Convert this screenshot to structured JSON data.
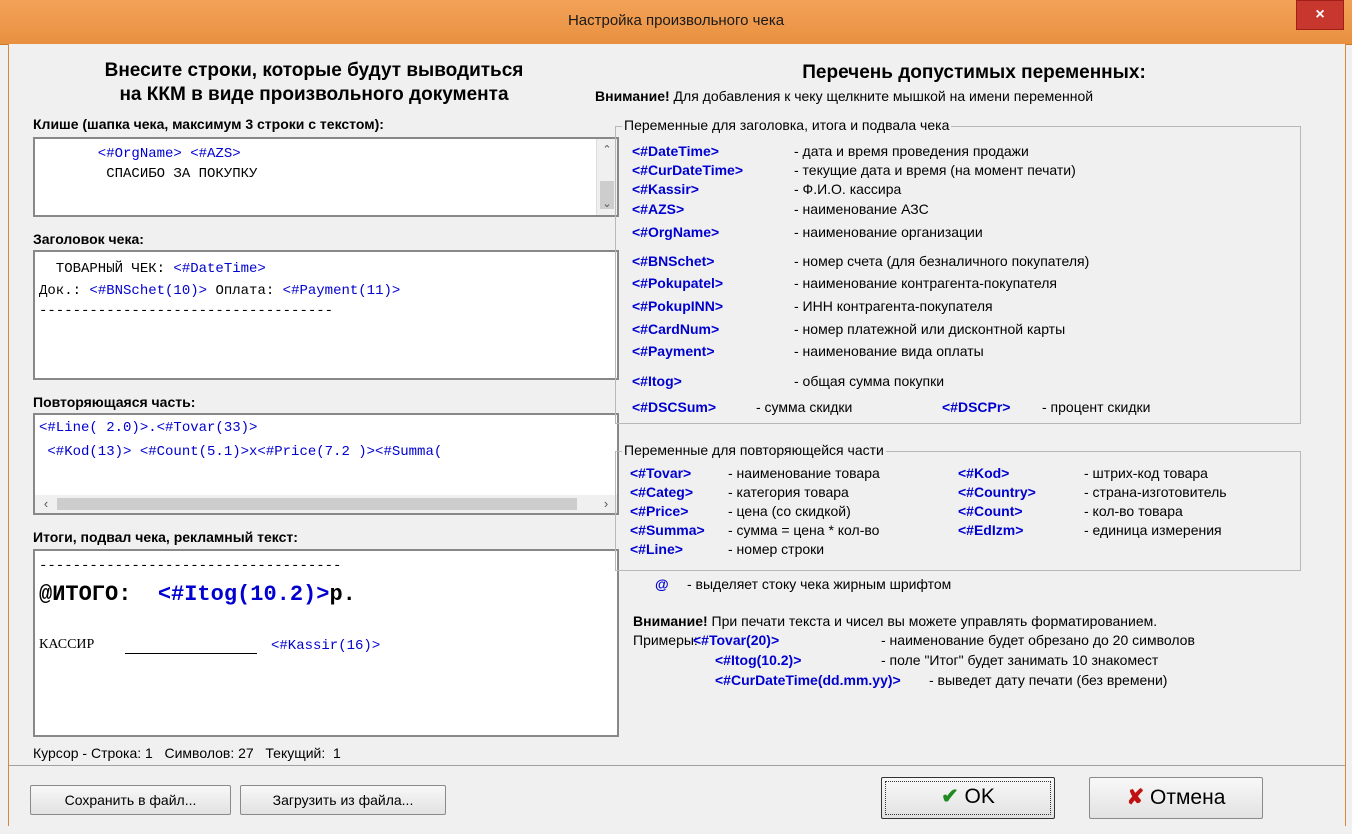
{
  "window": {
    "title": "Настройка произвольного чека",
    "close_glyph": "×"
  },
  "left": {
    "header": [
      "Внесите строки, которые будут выводиться",
      "на ККМ в виде произвольного документа"
    ],
    "cliche": {
      "label": "Клише (шапка чека, максимум 3 строки с текстом):",
      "line1": "       <#OrgName> <#AZS>",
      "line2": "        СПАСИБО ЗА ПОКУПКУ"
    },
    "heading": {
      "label": "Заголовок чека:",
      "line1_prefix": "  ТОВАРНЫЙ ЧЕК: ",
      "line1_var": "<#DateTime>",
      "line2_prefix": "Док.: ",
      "line2_var1": "<#BNSchet(10)>",
      "line2_mid": " Оплата: ",
      "line2_var2": "<#Payment(11)>",
      "line3": "-----------------------------------"
    },
    "repeat": {
      "label": "Повторяющаяся часть:",
      "line1": "<#Line( 2.0)>.<#Tovar(33)>",
      "line2": " <#Kod(13)> <#Count(5.1)>x<#Price(7.2 )><#Summa("
    },
    "totals": {
      "label": "Итоги, подвал чека, рекламный текст:",
      "line1": "------------------------------------",
      "itogo_prefix": "@ИТОГО:  ",
      "itogo_var": "<#Itog(10.2)>",
      "itogo_suffix": "р.",
      "kassir_label": "КАССИР",
      "kassir_var": "<#Kassir(16)>"
    },
    "status": "Курсор - Строка: 1   Символов: 27   Текущий:  1"
  },
  "right": {
    "header": "Перечень допустимых переменных:",
    "attention_bold": "Внимание!",
    "attention_text": " Для добавления к чеку щелкните мышкой на имени переменной",
    "group1": {
      "legend": "Переменные для заголовка, итога и подвала чека",
      "items": [
        {
          "var": "<#DateTime>",
          "desc": "- дата и время проведения продажи"
        },
        {
          "var": "<#CurDateTime>",
          "desc": "- текущие дата и время (на момент печати)"
        },
        {
          "var": "<#Kassir>",
          "desc": "- Ф.И.О. кассира"
        },
        {
          "var": "<#AZS>",
          "desc": "- наименование АЗС"
        },
        {
          "var": "<#OrgName>",
          "desc": "- наименование организации"
        },
        {
          "var": "<#BNSchet>",
          "desc": "- номер счета (для безналичного покупателя)"
        },
        {
          "var": "<#Pokupatel>",
          "desc": "- наименование контрагента-покупателя"
        },
        {
          "var": "<#PokupINN>",
          "desc": "- ИНН контрагента-покупателя"
        },
        {
          "var": "<#CardNum>",
          "desc": "- номер платежной или дисконтной карты"
        },
        {
          "var": "<#Payment>",
          "desc": "- наименование вида оплаты"
        },
        {
          "var": "<#Itog>",
          "desc": "- общая сумма покупки"
        }
      ],
      "dsc_sum_var": "<#DSCSum>",
      "dsc_sum_desc": "- сумма скидки",
      "dsc_pr_var": "<#DSCPr>",
      "dsc_pr_desc": "- процент скидки"
    },
    "group2": {
      "legend": "Переменные для повторяющейся части",
      "left": [
        {
          "var": "<#Tovar>",
          "desc": "- наименование товара"
        },
        {
          "var": "<#Categ>",
          "desc": "- категория товара"
        },
        {
          "var": "<#Price>",
          "desc": "- цена (со скидкой)"
        },
        {
          "var": "<#Summa>",
          "desc": "- сумма = цена * кол-во"
        },
        {
          "var": "<#Line>",
          "desc": "- номер строки"
        }
      ],
      "right": [
        {
          "var": "<#Kod>",
          "desc": "- штрих-код товара"
        },
        {
          "var": "<#Country>",
          "desc": "- страна-изготовитель"
        },
        {
          "var": "<#Count>",
          "desc": "- кол-во товара"
        },
        {
          "var": "<#EdIzm>",
          "desc": "- единица измерения"
        }
      ]
    },
    "bold_at": "@",
    "bold_at_desc": "- выделяет стоку чека жирным шрифтом",
    "note_bold": "Внимание!",
    "note_text": " При печати текста и чисел вы можете управлять форматированием.",
    "examples_label": "Примеры:",
    "ex1_var": "<#Tovar(20)>",
    "ex1_desc": "- наименование будет обрезано до 20 символов",
    "ex2_var": "<#Itog(10.2)>",
    "ex2_desc": "- поле \"Итог\" будет занимать 10 знакомест",
    "ex3_var": "<#CurDateTime(dd.mm.yy)>",
    "ex3_desc": "- выведет дату печати (без времени)"
  },
  "buttons": {
    "save": "Сохранить в файл...",
    "load": "Загрузить из файла...",
    "ok": "OK",
    "ok_icon": "✔",
    "cancel": "Отмена",
    "cancel_icon": "✘"
  }
}
